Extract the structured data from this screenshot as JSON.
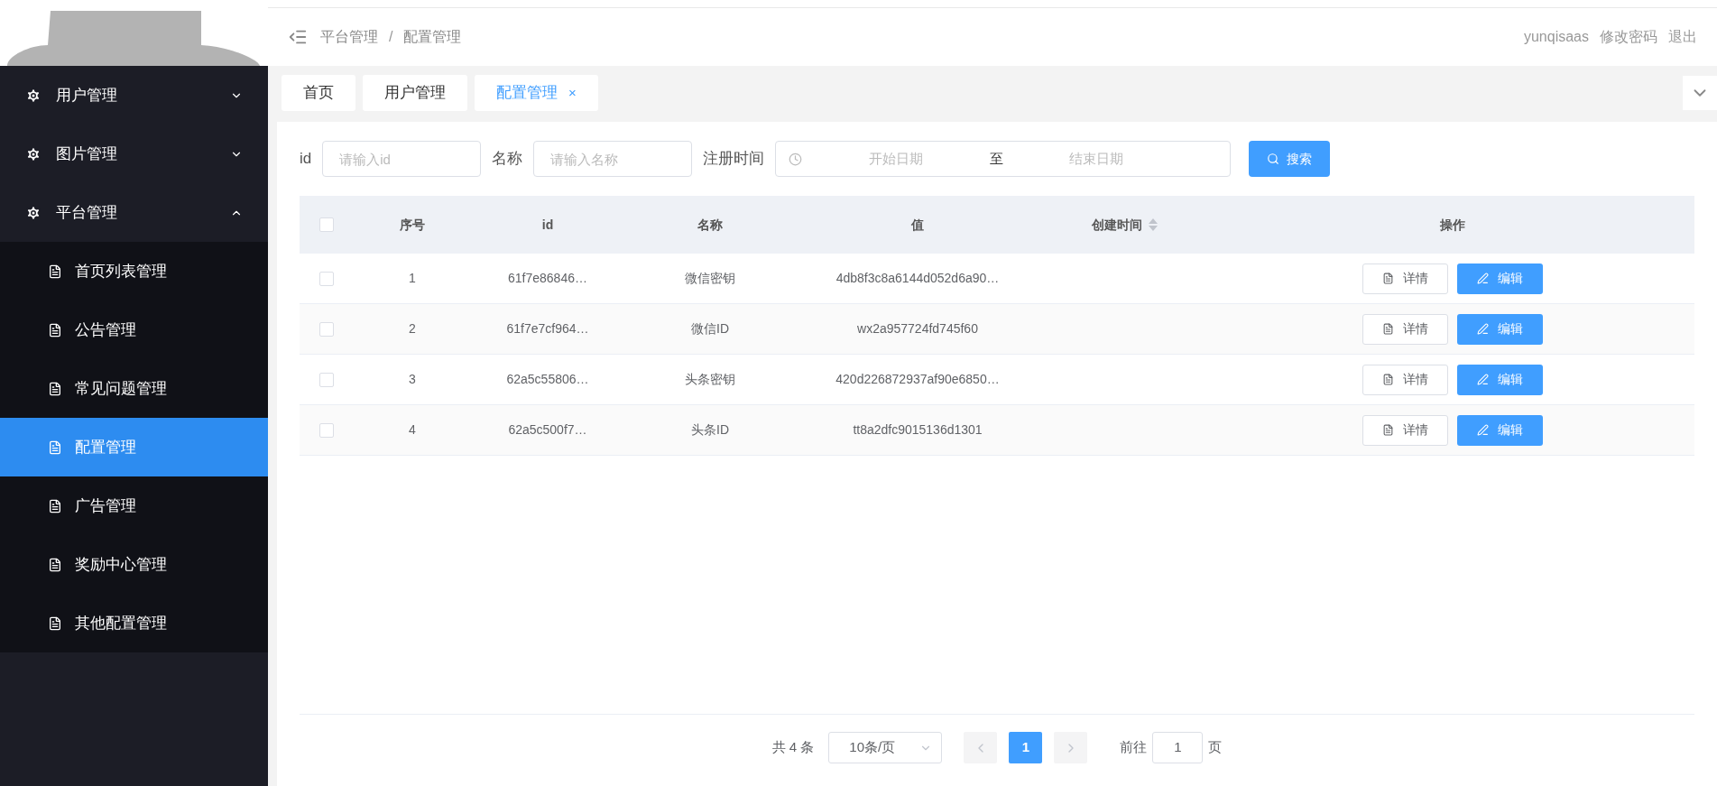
{
  "breadcrumb": {
    "items": [
      "平台管理",
      "配置管理"
    ],
    "separator": "/"
  },
  "header_links": [
    "yunqisaas",
    "修改密码",
    "退出"
  ],
  "sidebar": {
    "items": [
      {
        "label": "用户管理",
        "expanded": false
      },
      {
        "label": "图片管理",
        "expanded": false
      },
      {
        "label": "平台管理",
        "expanded": true,
        "children": [
          {
            "label": "首页列表管理",
            "selected": false
          },
          {
            "label": "公告管理",
            "selected": false
          },
          {
            "label": "常见问题管理",
            "selected": false
          },
          {
            "label": "配置管理",
            "selected": true
          },
          {
            "label": "广告管理",
            "selected": false
          },
          {
            "label": "奖励中心管理",
            "selected": false
          },
          {
            "label": "其他配置管理",
            "selected": false
          }
        ]
      }
    ]
  },
  "tabs": [
    {
      "label": "首页",
      "selected": false
    },
    {
      "label": "用户管理",
      "selected": false
    },
    {
      "label": "配置管理",
      "selected": true,
      "close": "×"
    }
  ],
  "search": {
    "fields": [
      {
        "label": "id",
        "placeholder": "请输入id"
      },
      {
        "label": "名称",
        "placeholder": "请输入名称"
      }
    ],
    "date_range": {
      "label": "注册时间",
      "start_placeholder": "开始日期",
      "separator": "至",
      "end_placeholder": "结束日期"
    },
    "button": "搜索"
  },
  "table": {
    "select_all_checked": false,
    "columns": [
      "序号",
      "id",
      "名称",
      "值",
      "创建时间",
      "操作"
    ],
    "rows": [
      {
        "checked": false,
        "cells": [
          "1",
          "61f7e86846…",
          "微信密钥",
          "4db8f3c8a6144d052d6a90…",
          ""
        ],
        "actions": [
          "详情",
          "编辑"
        ]
      },
      {
        "checked": false,
        "cells": [
          "2",
          "61f7e7cf964…",
          "微信ID",
          "wx2a957724fd745f60",
          ""
        ],
        "actions": [
          "详情",
          "编辑"
        ]
      },
      {
        "checked": false,
        "cells": [
          "3",
          "62a5c55806…",
          "头条密钥",
          "420d226872937af90e6850…",
          ""
        ],
        "actions": [
          "详情",
          "编辑"
        ]
      },
      {
        "checked": false,
        "cells": [
          "4",
          "62a5c500f7…",
          "头条ID",
          "tt8a2dfc9015136d1301",
          ""
        ],
        "actions": [
          "详情",
          "编辑"
        ]
      }
    ]
  },
  "pagination": {
    "total": "共 4 条",
    "page_size": "10条/页",
    "pages": [
      {
        "label": "1",
        "selected": true
      }
    ],
    "goto_label": "前往",
    "goto_value": "1",
    "goto_suffix": "页"
  }
}
